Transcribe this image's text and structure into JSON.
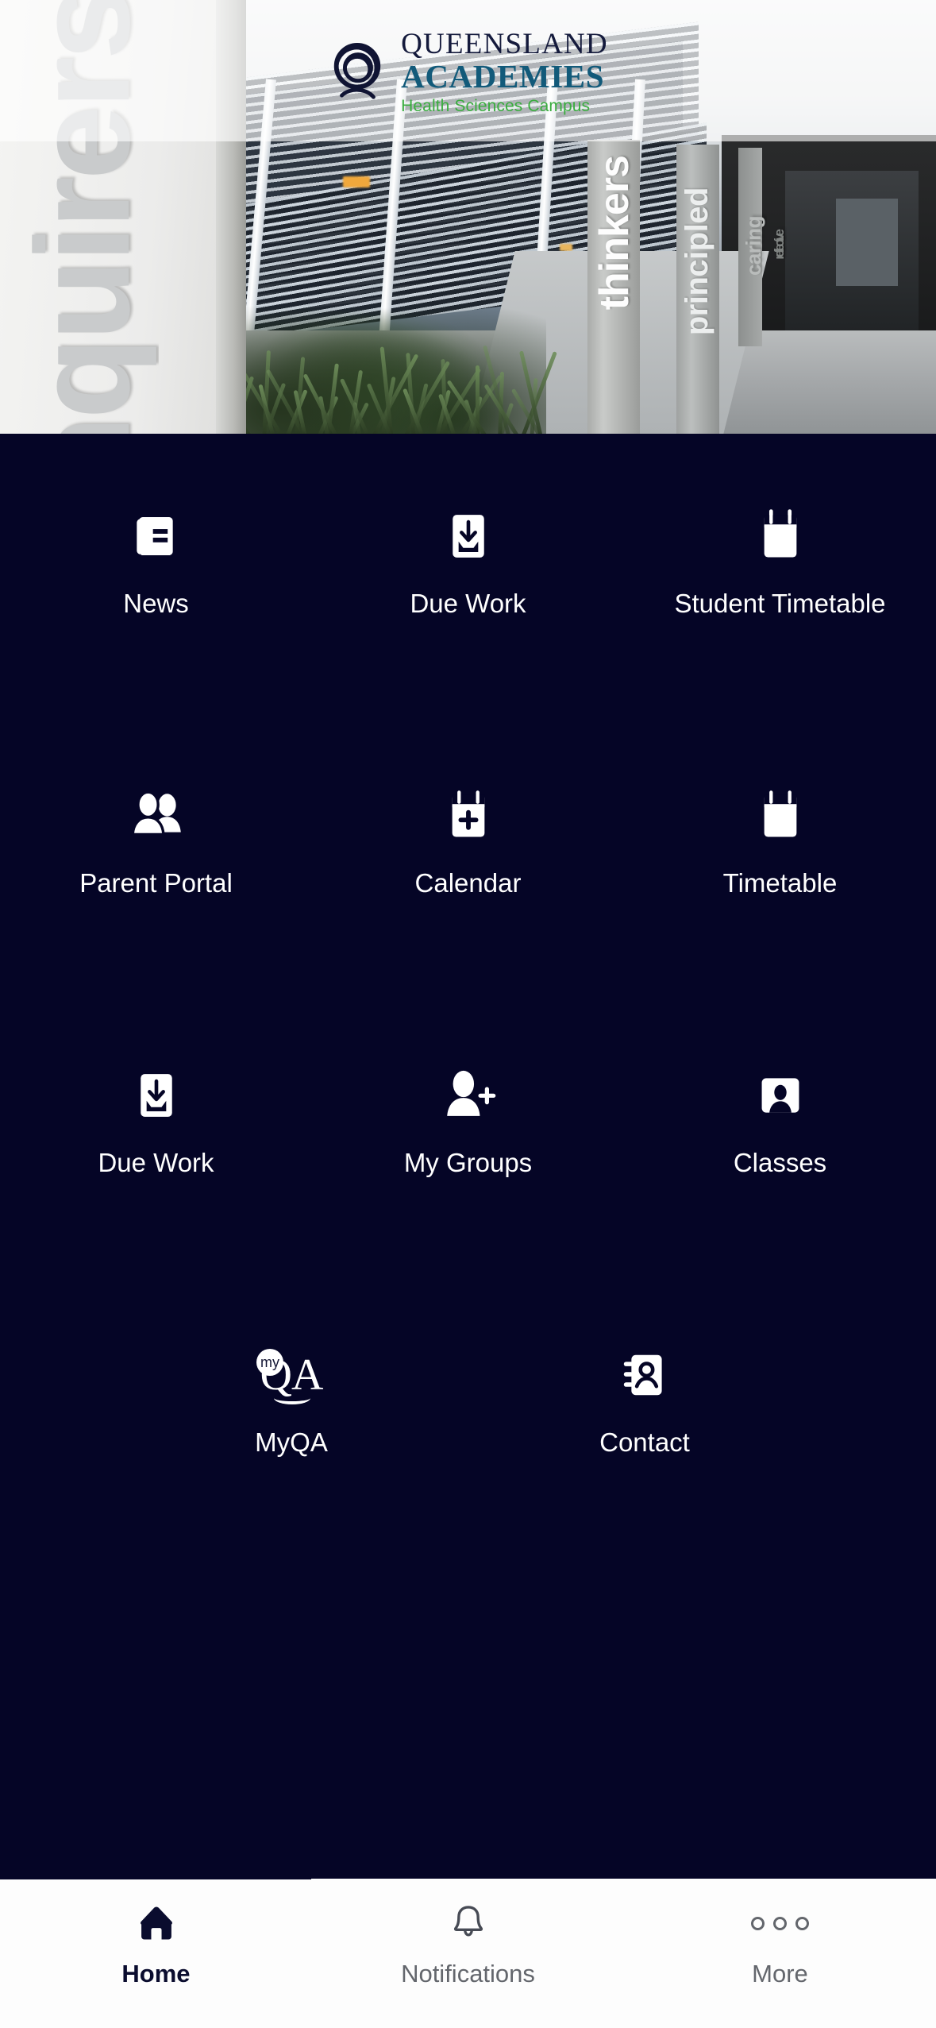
{
  "app": {
    "background_color": "#050526",
    "accent_color": "#0a0c2e"
  },
  "hero": {
    "wall_words": {
      "primary": "inquirers",
      "secondary": "thinkers",
      "tertiary": "principled",
      "quaternary": "caring",
      "quinary": "reflective"
    },
    "logo": {
      "icon_name": "queensland-academies-spiral-logo",
      "line1": "QUEENSLAND",
      "line2": "ACADEMIES",
      "line3": "Health Sciences Campus",
      "line1_color": "#141a3c",
      "line2_color": "#125a7a",
      "line3_color": "#3aad3f"
    }
  },
  "grid": {
    "tiles": [
      {
        "label": "News",
        "icon": "newspaper-icon"
      },
      {
        "label": "Due Work",
        "icon": "download-inbox-icon"
      },
      {
        "label": "Student Timetable",
        "icon": "calendar-icon"
      },
      {
        "label": "Parent Portal",
        "icon": "two-people-icon"
      },
      {
        "label": "Calendar",
        "icon": "calendar-plus-icon"
      },
      {
        "label": "Timetable",
        "icon": "calendar-icon"
      },
      {
        "label": "Due Work",
        "icon": "download-inbox-icon"
      },
      {
        "label": "My Groups",
        "icon": "person-add-icon"
      },
      {
        "label": "Classes",
        "icon": "portrait-frame-icon"
      }
    ],
    "tiles_last_row": [
      {
        "label": "MyQA",
        "icon": "myqa-logo-icon",
        "mark_prefix": "my",
        "mark_text": "QA"
      },
      {
        "label": "Contact",
        "icon": "address-book-icon"
      }
    ]
  },
  "tabbar": {
    "tabs": [
      {
        "label": "Home",
        "icon": "home-icon",
        "active": true
      },
      {
        "label": "Notifications",
        "icon": "bell-icon",
        "active": false
      },
      {
        "label": "More",
        "icon": "ellipsis-icon",
        "active": false
      }
    ]
  }
}
